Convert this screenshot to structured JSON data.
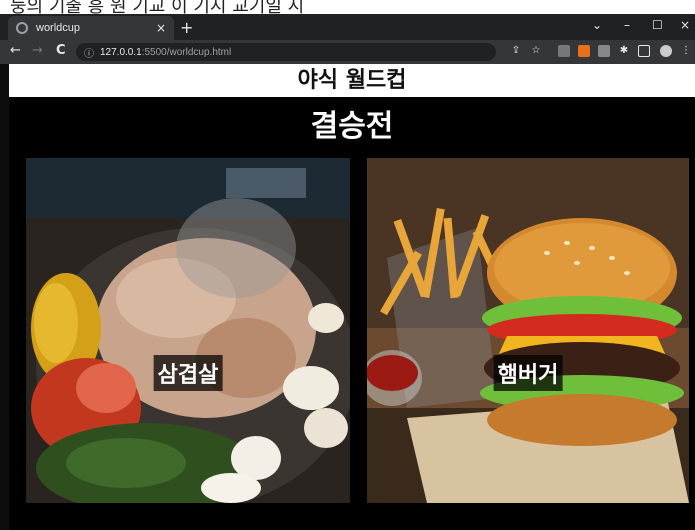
{
  "caption": {
    "text": "둥의 기출 흥 원 기교 이 기시 교기일 시"
  },
  "browser": {
    "tab": {
      "title": "worldcup",
      "close": "×"
    },
    "new_tab": "+",
    "window": {
      "chevron": "⌄",
      "minimize": "–",
      "maximize": "☐",
      "close": "×"
    },
    "nav": {
      "back": "←",
      "forward": "→",
      "reload": "C"
    },
    "address": {
      "host": "127.0.0.1",
      "path": ":5500/worldcup.html"
    }
  },
  "page": {
    "heading": "야식 월드컵",
    "round_title": "결승전",
    "candidates": [
      {
        "label": "삼겹살"
      },
      {
        "label": "햄버거"
      }
    ]
  },
  "colors": {
    "page_bg": "#000000",
    "chrome_dark": "#202124",
    "chrome_mid": "#35363a",
    "label_bg": "#000000"
  }
}
